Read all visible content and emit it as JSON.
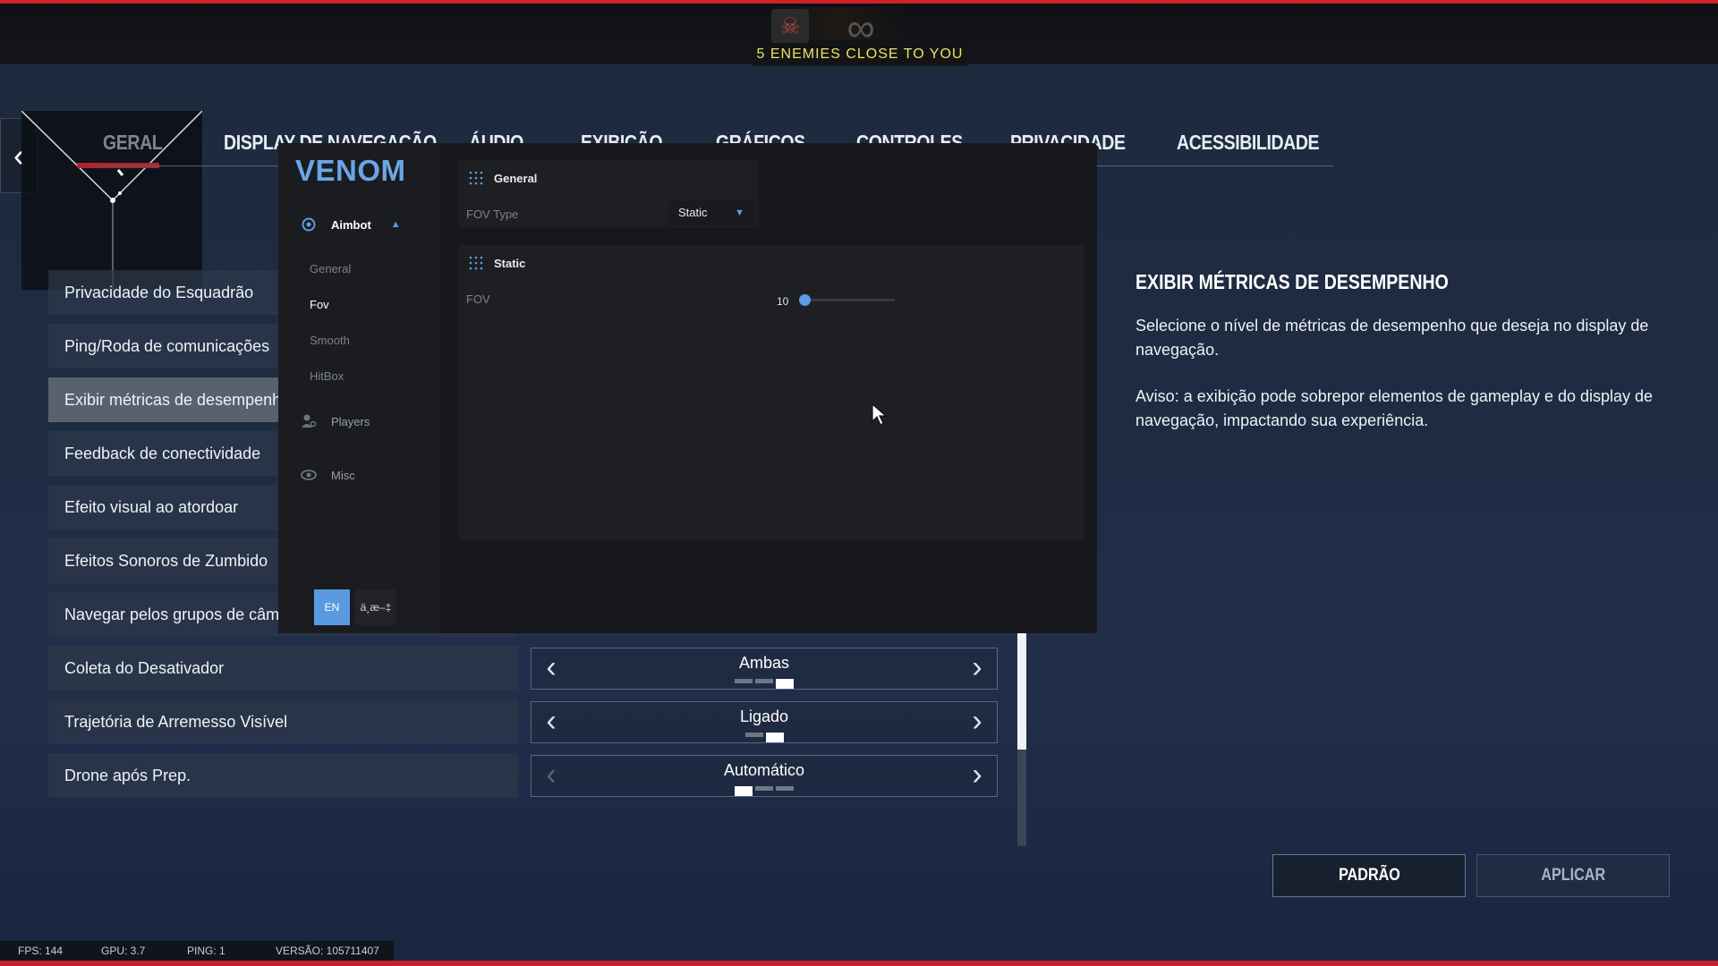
{
  "hud": {
    "enemies_banner": "5 ENEMIES CLOSE TO YOU"
  },
  "nav_tabs": [
    {
      "label": "GERAL"
    },
    {
      "label": "DISPLAY DE NAVEGAÇÃO"
    },
    {
      "label": "ÁUDIO"
    },
    {
      "label": "EXIBIÇÃO"
    },
    {
      "label": "GRÁFICOS"
    },
    {
      "label": "CONTROLES"
    },
    {
      "label": "PRIVACIDADE"
    },
    {
      "label": "ACESSIBILIDADE"
    }
  ],
  "settings": [
    {
      "label": "Privacidade do Esquadrão"
    },
    {
      "label": "Ping/Roda de comunicações"
    },
    {
      "label": "Exibir métricas de desempenho"
    },
    {
      "label": "Feedback de conectividade"
    },
    {
      "label": "Efeito visual ao atordoar"
    },
    {
      "label": "Efeitos Sonoros de Zumbido"
    },
    {
      "label": "Navegar pelos grupos de câmeras"
    },
    {
      "label": "Coleta do Desativador",
      "value": "Ambas",
      "options_count": 3,
      "selected_index": 2
    },
    {
      "label": "Trajetória de Arremesso Visível",
      "value": "Ligado",
      "options_count": 2,
      "selected_index": 1
    },
    {
      "label": "Drone após Prep.",
      "value": "Automático",
      "options_count": 3,
      "selected_index": 0
    }
  ],
  "info": {
    "title": "EXIBIR MÉTRICAS DE DESEMPENHO",
    "text1": "Selecione o nível de métricas de desempenho que deseja no display de navegação.",
    "text2": "Aviso: a exibição pode sobrepor elementos de gameplay e do display de navegação, impactando sua experiência."
  },
  "buttons": {
    "default": "PADRÃO",
    "apply": "APLICAR"
  },
  "status": {
    "fps": "FPS: 144",
    "gpu": "GPU: 3.7",
    "ping": "PING: 1",
    "version": "VERSÃO: 105711407"
  },
  "venom": {
    "logo": "VENOM",
    "nav": {
      "aimbot": "Aimbot",
      "players": "Players",
      "misc": "Misc"
    },
    "aimbot_sub": [
      "General",
      "Fov",
      "Smooth",
      "HitBox"
    ],
    "lang_en": "EN",
    "lang_alt": "ä¸­æ–‡",
    "general_panel": {
      "title": "General",
      "fov_type_label": "FOV Type",
      "fov_type_value": "Static"
    },
    "static_panel": {
      "title": "Static",
      "fov_label": "FOV",
      "fov_value": "10",
      "fov_fraction": 0.05
    }
  },
  "colors": {
    "accent_red": "#c7222c",
    "venom_blue": "#5b9ce4",
    "banner_yellow": "#e8e26a"
  }
}
